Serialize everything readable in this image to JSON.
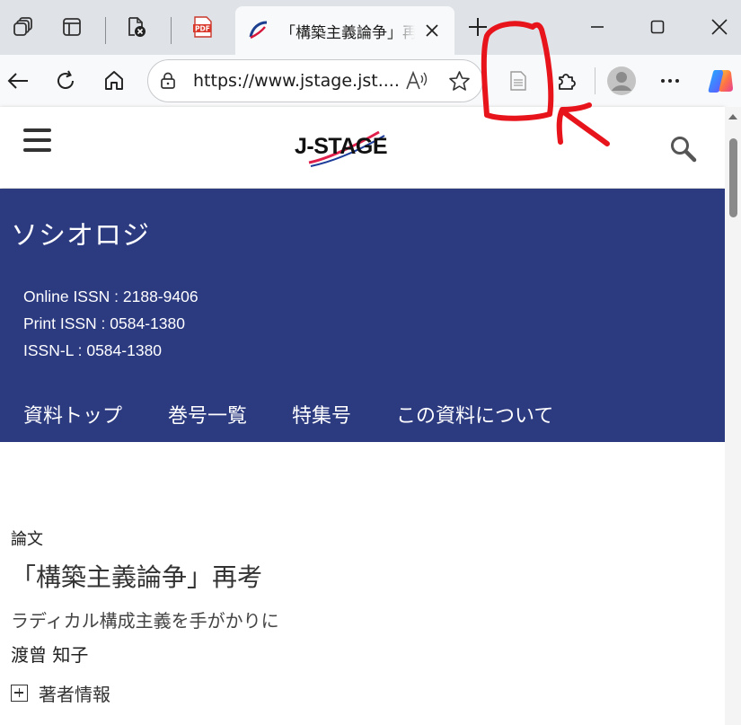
{
  "browser": {
    "tab": {
      "title": "「構築主義論争」再考",
      "close_icon": "close-icon"
    },
    "address_bar": {
      "url": "https://www.jstage.jst...."
    },
    "icons": [
      "workspaces-icon",
      "tab-actions-icon",
      "tab-favicon-blocked-icon",
      "pdf-icon",
      "new-tab-icon",
      "minimize-icon",
      "maximize-icon",
      "close-icon",
      "back-icon",
      "refresh-icon",
      "home-icon",
      "site-info-icon",
      "read-aloud-icon",
      "favorite-star-icon",
      "immersive-reader-icon",
      "extensions-icon",
      "profile-icon",
      "more-icon",
      "copilot-icon"
    ]
  },
  "site": {
    "logo_text": "J-STAGE"
  },
  "journal": {
    "title": "ソシオロジ",
    "issn": [
      "Online ISSN : 2188-9406",
      "Print ISSN : 0584-1380",
      "ISSN-L : 0584-1380"
    ],
    "nav": [
      "資料トップ",
      "巻号一覧",
      "特集号",
      "この資料について"
    ]
  },
  "article": {
    "type": "論文",
    "title": "「構築主義論争」再考",
    "subtitle": "ラディカル構成主義を手がかりに",
    "author": "渡曾 知子",
    "author_info_label": "著者情報"
  },
  "colors": {
    "journal_band": "#2c3a80",
    "annotation": "#e8141c",
    "tabstrip": "#dfe3e8"
  }
}
